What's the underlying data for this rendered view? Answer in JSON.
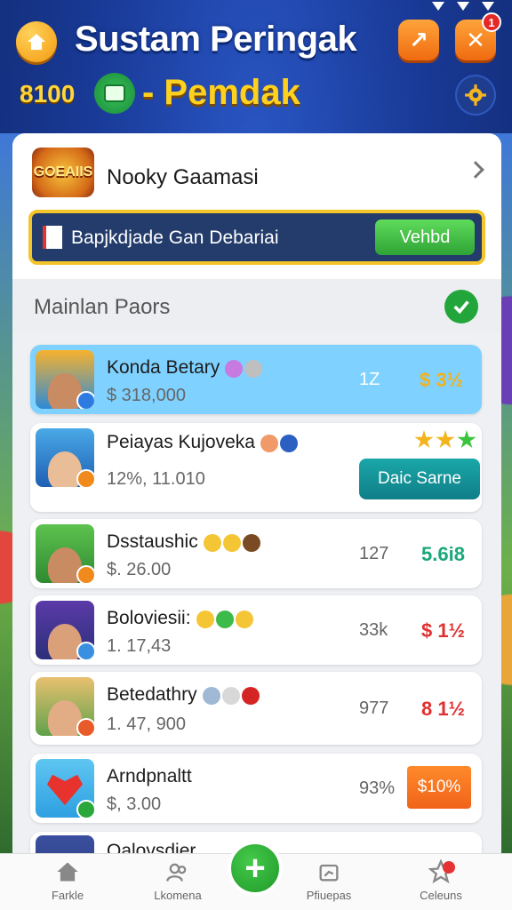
{
  "header": {
    "title": "Sustam Peringak",
    "notif_count": "1"
  },
  "subheader": {
    "coins": "8100",
    "title": "- Pemdak"
  },
  "profile": {
    "badge_text": "GOEAIIS",
    "name": "Nooky Gaamasi"
  },
  "banner": {
    "text": "Bapjkdjade Gan Debariai",
    "button_label": "Vehbd"
  },
  "section": {
    "title": "Mainlan Paors"
  },
  "rows": [
    {
      "name": "Konda Betary",
      "sub": "$ 318,000",
      "mid": "1Z",
      "value": "$ 3½",
      "value_color": "#f2b21a",
      "highlighted": true
    },
    {
      "name": "Peiayas Kujoveka",
      "sub": "12%, 11.010",
      "button": "Daic Sarne",
      "stars": 3
    },
    {
      "name": "Dsstaushic",
      "sub": "$. 26.00",
      "mid": "127",
      "value": "5.6i8",
      "value_color": "#1aa77a"
    },
    {
      "name": "Boloviesii:",
      "sub": "1. 17,43",
      "mid": "33k",
      "value": "$ 1½",
      "value_color": "#e03030"
    },
    {
      "name": "Betedathry",
      "sub": "1. 47, 900",
      "mid": "977",
      "value": "8 1½",
      "value_color": "#e03030"
    },
    {
      "name": "Arndpnaltt",
      "sub": "$, 3.00",
      "mid": "93%",
      "button": "$10%"
    },
    {
      "name": "Oalovsdier"
    }
  ],
  "nav": {
    "items": [
      "Farkle",
      "Lkomena",
      "Pfiuepas",
      "Celeuns"
    ]
  },
  "colors": {
    "accent_orange": "#f39a10",
    "accent_green": "#22a63b",
    "highlight_blue": "#7fd1ff"
  }
}
